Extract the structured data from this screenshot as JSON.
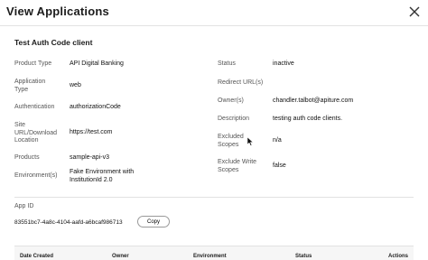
{
  "modal": {
    "title": "View Applications",
    "close_icon": "close-icon"
  },
  "app": {
    "name": "Test Auth Code client",
    "left_fields": [
      {
        "label": "Product Type",
        "value": "API Digital Banking"
      },
      {
        "label": "Application Type",
        "value": "web"
      },
      {
        "label": "Authentication",
        "value": "authorizationCode"
      },
      {
        "label": "Site URL/Download Location",
        "value": "https://test.com"
      },
      {
        "label": "Products",
        "value": "sample-api-v3"
      },
      {
        "label": "Environment(s)",
        "value": "Fake Environment with InstitutionId 2.0"
      }
    ],
    "right_fields": [
      {
        "label": "Status",
        "value": "inactive"
      },
      {
        "label": "Redirect URL(s)",
        "value": ""
      },
      {
        "label": "Owner(s)",
        "value": "chandler.talbot@apiture.com"
      },
      {
        "label": "Description",
        "value": "testing auth code clients."
      },
      {
        "label": "Excluded Scopes",
        "value": "n/a"
      },
      {
        "label": "Exclude Write Scopes",
        "value": "false"
      }
    ],
    "app_id_label": "App ID",
    "app_id": "83551bc7-4a8c-4104-aafd-a6bcaf986713",
    "copy_label": "Copy"
  },
  "table": {
    "headers": [
      "Date Created",
      "Owner",
      "Environment",
      "Status",
      "Actions"
    ]
  }
}
